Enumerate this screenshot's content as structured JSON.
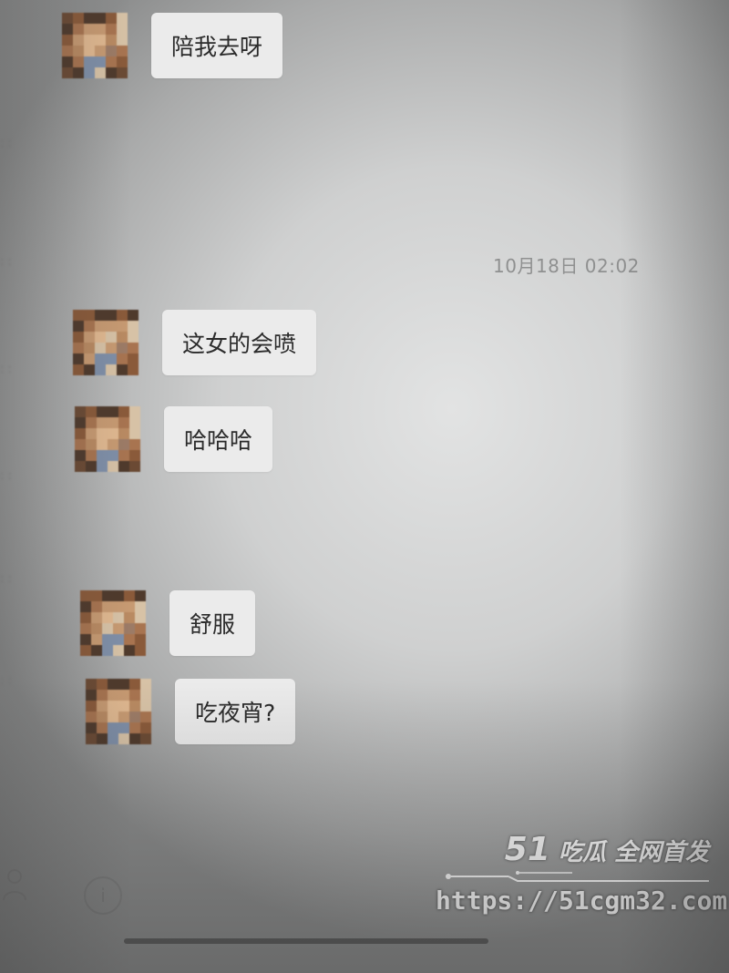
{
  "timestamp": "10月18日 02:02",
  "messages": [
    {
      "text": "陪我去呀"
    },
    {
      "text": "这女的会喷"
    },
    {
      "text": "哈哈哈"
    },
    {
      "text": "舒服"
    },
    {
      "text": "吃夜宵?"
    }
  ],
  "watermark": {
    "brand_number": "51",
    "brand_text": "吃瓜 全网首发",
    "url": "https://51cgm32.com"
  },
  "icons": {
    "avatar": "pixelated-avatar",
    "contact": "person-icon",
    "extra": "circle-icon"
  },
  "colors": {
    "bubble_bg": "#ebebeb",
    "text": "#2b2b2b",
    "timestamp": "#8f9090",
    "watermark": "#ffffff"
  }
}
